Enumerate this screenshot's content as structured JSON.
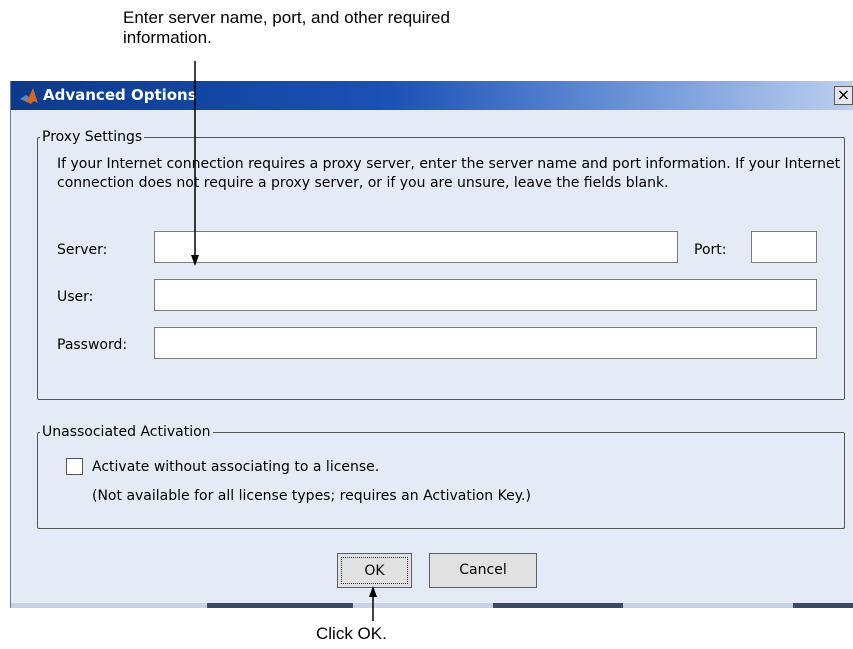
{
  "callouts": {
    "top": "Enter server name, port, and other required information.",
    "bottom": "Click OK."
  },
  "window": {
    "title": "Advanced Options",
    "close_glyph": "×",
    "app_icon": "matlab-logo-icon"
  },
  "proxy": {
    "legend": "Proxy Settings",
    "description": "If your Internet connection requires a proxy server, enter the server name and port information. If your Internet connection does not require a proxy server, or if you are unsure, leave the fields blank.",
    "server_label": "Server:",
    "server_value": "",
    "port_label": "Port:",
    "port_value": "",
    "user_label": "User:",
    "user_value": "",
    "password_label": "Password:",
    "password_value": ""
  },
  "activation": {
    "legend": "Unassociated Activation",
    "checkbox_label": "Activate without associating to a license.",
    "checked": false,
    "note": "(Not available for all license types; requires an Activation Key.)"
  },
  "buttons": {
    "ok": "OK",
    "cancel": "Cancel"
  },
  "colors": {
    "titlebar_start": "#0b3a8c",
    "dialog_background": "#e4ebf7"
  }
}
